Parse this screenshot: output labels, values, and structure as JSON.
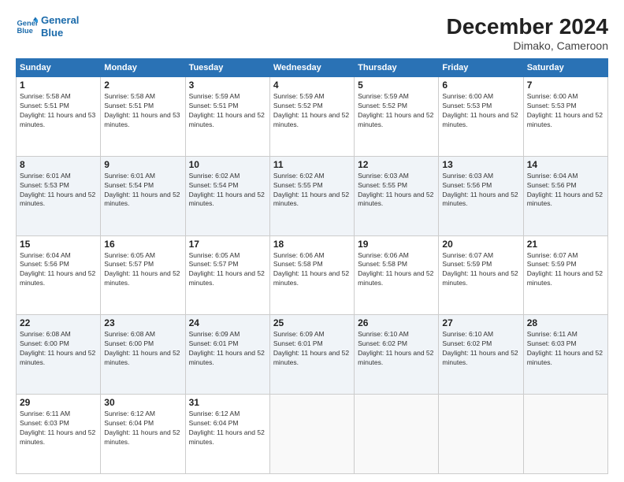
{
  "header": {
    "logo_line1": "General",
    "logo_line2": "Blue",
    "title": "December 2024",
    "subtitle": "Dimako, Cameroon"
  },
  "days_of_week": [
    "Sunday",
    "Monday",
    "Tuesday",
    "Wednesday",
    "Thursday",
    "Friday",
    "Saturday"
  ],
  "weeks": [
    [
      {
        "day": "1",
        "sunrise": "5:58 AM",
        "sunset": "5:51 PM",
        "daylight": "11 hours and 53 minutes."
      },
      {
        "day": "2",
        "sunrise": "5:58 AM",
        "sunset": "5:51 PM",
        "daylight": "11 hours and 53 minutes."
      },
      {
        "day": "3",
        "sunrise": "5:59 AM",
        "sunset": "5:51 PM",
        "daylight": "11 hours and 52 minutes."
      },
      {
        "day": "4",
        "sunrise": "5:59 AM",
        "sunset": "5:52 PM",
        "daylight": "11 hours and 52 minutes."
      },
      {
        "day": "5",
        "sunrise": "5:59 AM",
        "sunset": "5:52 PM",
        "daylight": "11 hours and 52 minutes."
      },
      {
        "day": "6",
        "sunrise": "6:00 AM",
        "sunset": "5:53 PM",
        "daylight": "11 hours and 52 minutes."
      },
      {
        "day": "7",
        "sunrise": "6:00 AM",
        "sunset": "5:53 PM",
        "daylight": "11 hours and 52 minutes."
      }
    ],
    [
      {
        "day": "8",
        "sunrise": "6:01 AM",
        "sunset": "5:53 PM",
        "daylight": "11 hours and 52 minutes."
      },
      {
        "day": "9",
        "sunrise": "6:01 AM",
        "sunset": "5:54 PM",
        "daylight": "11 hours and 52 minutes."
      },
      {
        "day": "10",
        "sunrise": "6:02 AM",
        "sunset": "5:54 PM",
        "daylight": "11 hours and 52 minutes."
      },
      {
        "day": "11",
        "sunrise": "6:02 AM",
        "sunset": "5:55 PM",
        "daylight": "11 hours and 52 minutes."
      },
      {
        "day": "12",
        "sunrise": "6:03 AM",
        "sunset": "5:55 PM",
        "daylight": "11 hours and 52 minutes."
      },
      {
        "day": "13",
        "sunrise": "6:03 AM",
        "sunset": "5:56 PM",
        "daylight": "11 hours and 52 minutes."
      },
      {
        "day": "14",
        "sunrise": "6:04 AM",
        "sunset": "5:56 PM",
        "daylight": "11 hours and 52 minutes."
      }
    ],
    [
      {
        "day": "15",
        "sunrise": "6:04 AM",
        "sunset": "5:56 PM",
        "daylight": "11 hours and 52 minutes."
      },
      {
        "day": "16",
        "sunrise": "6:05 AM",
        "sunset": "5:57 PM",
        "daylight": "11 hours and 52 minutes."
      },
      {
        "day": "17",
        "sunrise": "6:05 AM",
        "sunset": "5:57 PM",
        "daylight": "11 hours and 52 minutes."
      },
      {
        "day": "18",
        "sunrise": "6:06 AM",
        "sunset": "5:58 PM",
        "daylight": "11 hours and 52 minutes."
      },
      {
        "day": "19",
        "sunrise": "6:06 AM",
        "sunset": "5:58 PM",
        "daylight": "11 hours and 52 minutes."
      },
      {
        "day": "20",
        "sunrise": "6:07 AM",
        "sunset": "5:59 PM",
        "daylight": "11 hours and 52 minutes."
      },
      {
        "day": "21",
        "sunrise": "6:07 AM",
        "sunset": "5:59 PM",
        "daylight": "11 hours and 52 minutes."
      }
    ],
    [
      {
        "day": "22",
        "sunrise": "6:08 AM",
        "sunset": "6:00 PM",
        "daylight": "11 hours and 52 minutes."
      },
      {
        "day": "23",
        "sunrise": "6:08 AM",
        "sunset": "6:00 PM",
        "daylight": "11 hours and 52 minutes."
      },
      {
        "day": "24",
        "sunrise": "6:09 AM",
        "sunset": "6:01 PM",
        "daylight": "11 hours and 52 minutes."
      },
      {
        "day": "25",
        "sunrise": "6:09 AM",
        "sunset": "6:01 PM",
        "daylight": "11 hours and 52 minutes."
      },
      {
        "day": "26",
        "sunrise": "6:10 AM",
        "sunset": "6:02 PM",
        "daylight": "11 hours and 52 minutes."
      },
      {
        "day": "27",
        "sunrise": "6:10 AM",
        "sunset": "6:02 PM",
        "daylight": "11 hours and 52 minutes."
      },
      {
        "day": "28",
        "sunrise": "6:11 AM",
        "sunset": "6:03 PM",
        "daylight": "11 hours and 52 minutes."
      }
    ],
    [
      {
        "day": "29",
        "sunrise": "6:11 AM",
        "sunset": "6:03 PM",
        "daylight": "11 hours and 52 minutes."
      },
      {
        "day": "30",
        "sunrise": "6:12 AM",
        "sunset": "6:04 PM",
        "daylight": "11 hours and 52 minutes."
      },
      {
        "day": "31",
        "sunrise": "6:12 AM",
        "sunset": "6:04 PM",
        "daylight": "11 hours and 52 minutes."
      },
      null,
      null,
      null,
      null
    ]
  ],
  "labels": {
    "sunrise": "Sunrise:",
    "sunset": "Sunset:",
    "daylight": "Daylight:"
  }
}
